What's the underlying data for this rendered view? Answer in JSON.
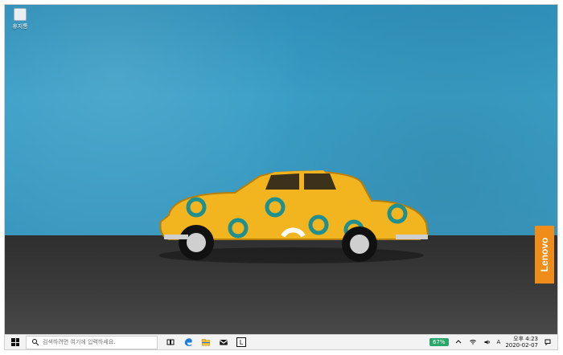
{
  "desktop": {
    "recycle_bin_label": "휴지통",
    "brand": "Lenovo"
  },
  "taskbar": {
    "search_placeholder": "검색하려면 여기에 입력하세요.",
    "apps": [
      {
        "name": "task-view",
        "label": ""
      },
      {
        "name": "edge",
        "label": ""
      },
      {
        "name": "file-explorer",
        "label": ""
      },
      {
        "name": "mail",
        "label": ""
      },
      {
        "name": "lenovo-vantage",
        "label": "L"
      }
    ],
    "tray": {
      "battery": "67%",
      "ime": "A",
      "time_ampm": "오후 4:23",
      "date": "2020-02-07"
    }
  },
  "colors": {
    "wall": "#3a9fc7",
    "car": "#f2b41f",
    "lenovo": "#f08c1a"
  }
}
